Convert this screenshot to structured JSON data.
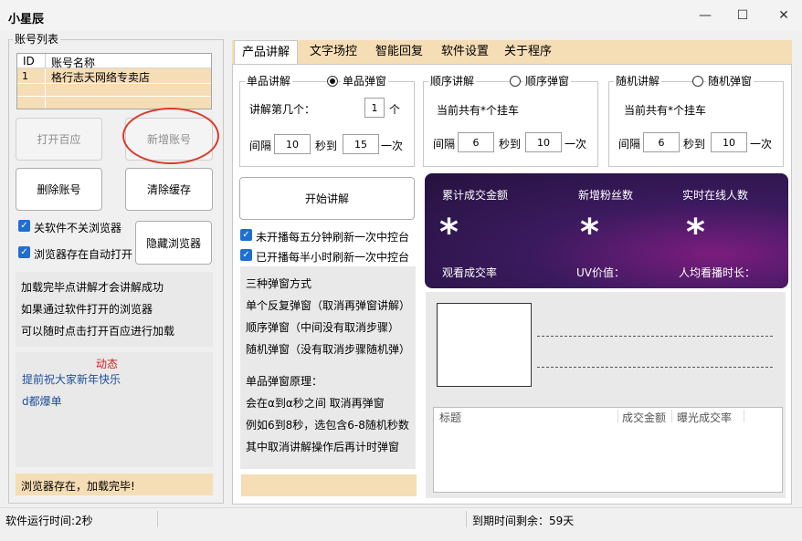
{
  "window": {
    "title": "小星辰"
  },
  "account_list": {
    "group_label": "账号列表",
    "columns": [
      "ID",
      "账号名称"
    ],
    "rows": [
      {
        "id": "1",
        "name": "格行志天网络专卖店"
      }
    ]
  },
  "buttons": {
    "open_baibaidian": "打开百应",
    "add_account": "新增账号",
    "delete_account": "删除账号",
    "clear_cache": "清除缓存",
    "hide_browser": "隐藏浏览器",
    "start_explain": "开始讲解"
  },
  "checkboxes": {
    "close_soft_not_browser": "关软件不关浏览器",
    "auto_open_browser": "浏览器存在自动打开",
    "refresh_5min": "未开播每五分钟刷新一次中控台",
    "refresh_30min": "已开播每半小时刷新一次中控台"
  },
  "hint_lines": [
    "加载完毕点讲解才会讲解成功",
    "如果通过软件打开的浏览器",
    "可以随时点击打开百应进行加载"
  ],
  "dynamic": {
    "title": "动态",
    "lines": [
      "提前祝大家新年快乐",
      "d都爆单"
    ]
  },
  "status_left": "浏览器存在，加载完毕!",
  "tabs": [
    "产品讲解",
    "文字场控",
    "智能回复",
    "软件设置",
    "关于程序"
  ],
  "single": {
    "label": "单品讲解",
    "radio": "单品弹窗",
    "which_label": "讲解第几个：",
    "which_value": "1",
    "which_unit": "个",
    "interval_label": "间隔",
    "from": "10",
    "to_label": "秒到",
    "to": "15",
    "per": "一次"
  },
  "sequence": {
    "label": "顺序讲解",
    "radio": "顺序弹窗",
    "info": "当前共有*个挂车",
    "interval_label": "间隔",
    "from": "6",
    "to_label": "秒到",
    "to": "10",
    "per": "一次"
  },
  "random": {
    "label": "随机讲解",
    "radio": "随机弹窗",
    "info": "当前共有*个挂车",
    "interval_label": "间隔",
    "from": "6",
    "to_label": "秒到",
    "to": "10",
    "per": "一次"
  },
  "stats": {
    "top_labels": [
      "累计成交金额",
      "新增粉丝数",
      "实时在线人数"
    ],
    "values": [
      "*",
      "*",
      "*"
    ],
    "bottom_labels": [
      "观看成交率",
      "UV价值：",
      "人均看播时长："
    ]
  },
  "explain_notes": [
    "三种弹窗方式",
    "单个反复弹窗（取消再弹窗讲解）",
    "顺序弹窗（中间没有取消步骤）",
    "随机弹窗（没有取消步骤随机弹）",
    "",
    "单品弹窗原理：",
    "会在α到α秒之间 取消再弹窗",
    "例如6到8秒，选包含6-8随机秒数",
    "其中取消讲解操作后再计时弹窗"
  ],
  "product_table": {
    "columns": [
      "标题",
      "成交金额",
      "曝光成交率"
    ]
  },
  "statusbar": {
    "runtime": "软件运行时间:2秒",
    "expiry": "到期时间剩余：59天"
  },
  "colors": {
    "accent_tan": "#f5ddb5",
    "stats_gradient_start": "#5b2a7e",
    "stats_gradient_end": "#2a1440",
    "red_circle": "#d93a2b",
    "checkbox_blue": "#1f6fd1"
  }
}
